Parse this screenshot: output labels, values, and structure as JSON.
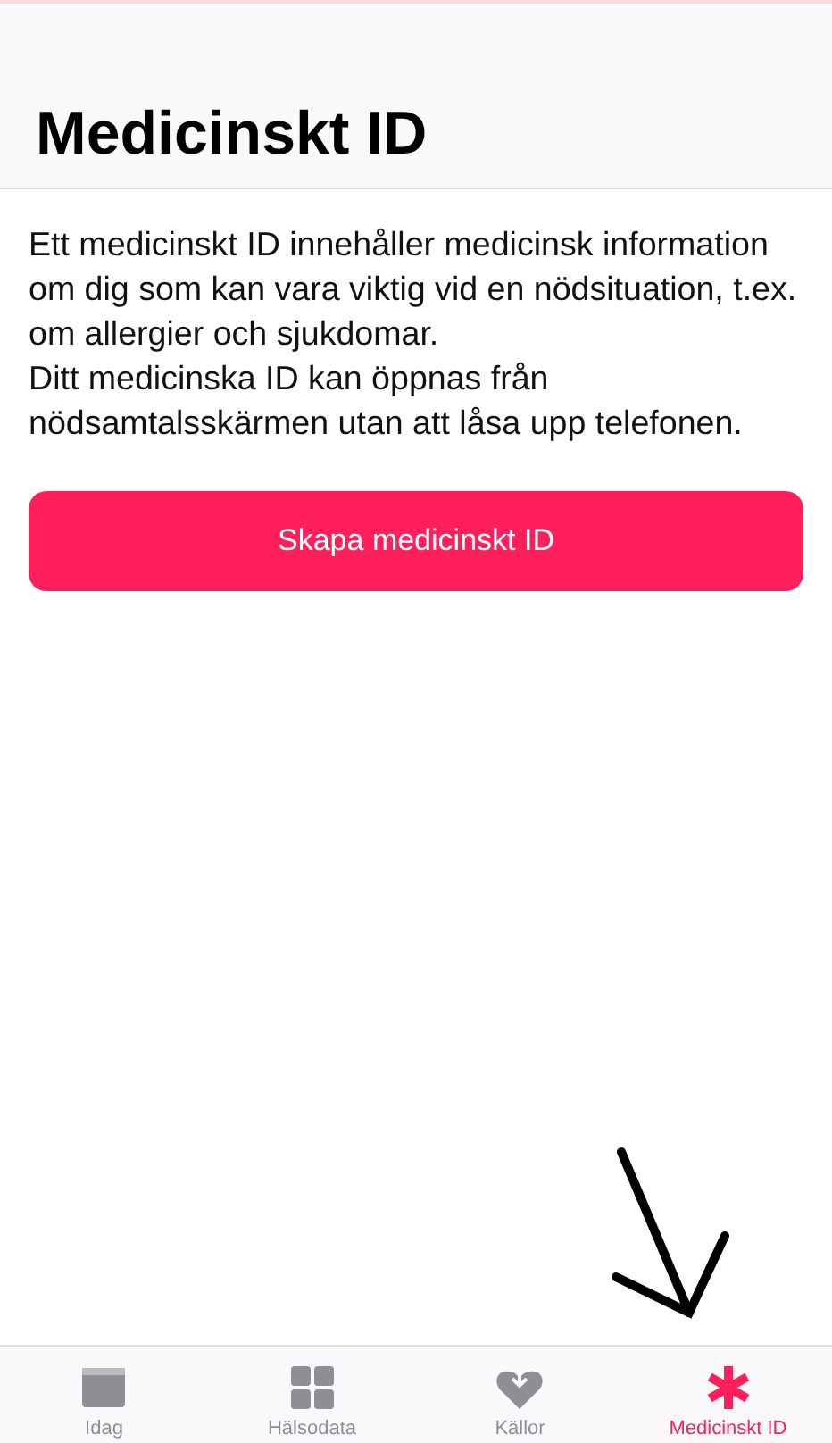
{
  "header": {
    "title": "Medicinskt ID"
  },
  "description": [
    "Ett medicinskt ID innehåller medicinsk information om dig som kan vara viktig vid en nödsituation, t.ex. om allergier och sjukdomar.",
    "Ditt medicinska ID kan öppnas från nödsamtalsskärmen utan att låsa upp telefonen."
  ],
  "create_button": "Skapa medicinskt ID",
  "annotation": {
    "kind": "arrow"
  },
  "tabs": [
    {
      "label": "Idag",
      "kind": "calendar",
      "selected": false
    },
    {
      "label": "Hälsodata",
      "kind": "grid",
      "selected": false
    },
    {
      "label": "Källor",
      "kind": "heart",
      "selected": false
    },
    {
      "label": "Medicinskt ID",
      "kind": "asterisk",
      "selected": true
    }
  ]
}
